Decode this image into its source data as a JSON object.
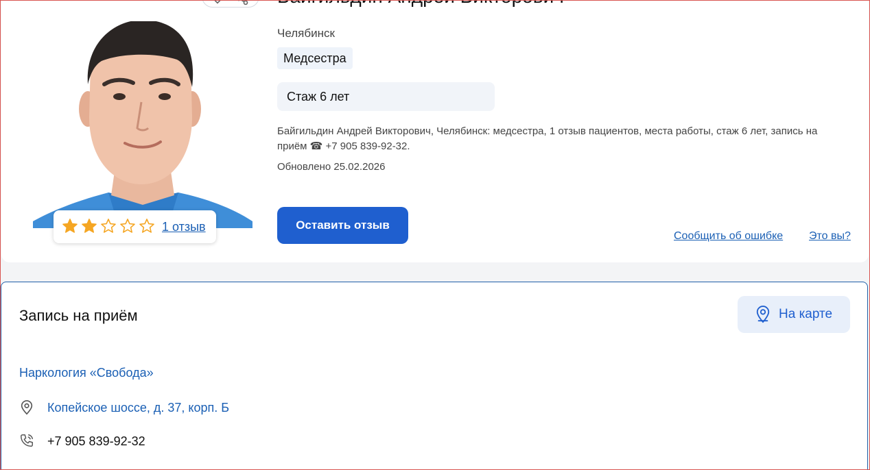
{
  "profile": {
    "name": "Байгильдин Андрей Викторович",
    "city": "Челябинск",
    "specialty": "Медсестра",
    "experience": "Стаж 6 лет",
    "description": "Байгильдин Андрей Викторович, Челябинск: медсестра, 1 отзыв пациентов, места работы, стаж 6 лет, запись на приём ☎ +7 905 839-92-32.",
    "updated": "Обновлено 25.02.2026",
    "rating": {
      "stars_filled": 2,
      "stars_total": 5,
      "reviews_link": "1 отзыв"
    },
    "leave_review_button": "Оставить отзыв",
    "report_error_link": "Сообщить об ошибке",
    "is_it_you_link": "Это вы?"
  },
  "appointment": {
    "title": "Запись на приём",
    "map_button": "На карте",
    "clinic_name": "Наркология «Свобода»",
    "address": "Копейское шоссе, д. 37, корп. Б",
    "phone": "+7 905 839-92-32"
  },
  "colors": {
    "accent": "#1f5fcf",
    "link": "#1a5fb4",
    "star": "#f5a623",
    "chip_bg": "#eef3fa"
  },
  "icons": {
    "favorite": "heart-icon",
    "share": "share-icon",
    "star": "star-icon",
    "map_pin": "map-pin-icon",
    "phone": "phone-icon"
  }
}
